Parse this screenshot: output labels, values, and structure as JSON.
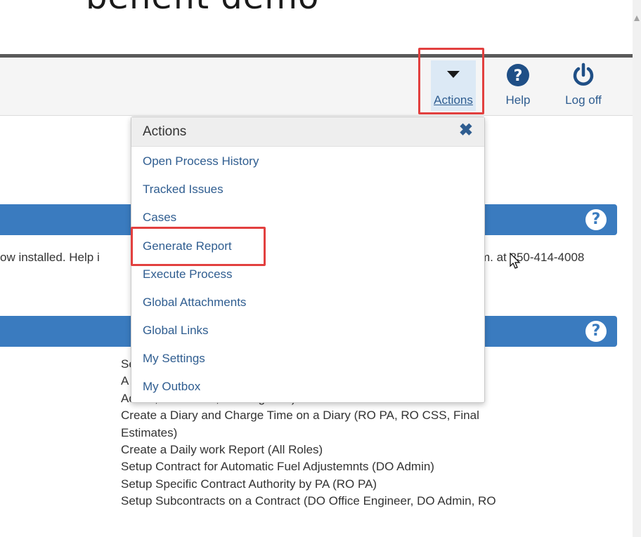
{
  "page_heading": "benefit demo",
  "header": {
    "actions_label": "Actions",
    "help_label": "Help",
    "logoff_label": "Log off"
  },
  "icons": {
    "actions": "caret-down-icon",
    "help": "question-circle-icon",
    "logoff": "power-icon",
    "close": "close-x-icon",
    "panel_help": "question-circle-icon"
  },
  "colors": {
    "accent": "#3a7bbf",
    "link": "#2f5d90",
    "highlight": "#e2403f"
  },
  "notice": {
    "left_text": "ow installed.  Help i",
    "right_text": "m. at 850-414-4008"
  },
  "actions_menu": {
    "title": "Actions",
    "items": [
      "Open Process History",
      "Tracked Issues",
      "Cases",
      "Generate Report",
      "Execute Process",
      "Global Attachments",
      "Global Links",
      "My Settings",
      "My Outbox"
    ]
  },
  "content_links": [
    "Se                                                          GR)",
    "A                                                            List (CO",
    "Admin, DO Admin, DO Engineer)",
    "Create a Diary and Charge Time on a Diary (RO PA, RO CSS, Final",
    "Estimates)",
    "Create a Daily work Report (All Roles)",
    "Setup Contract for Automatic Fuel Adjustemnts (DO Admin)",
    "Setup Specific Contract Authority by PA (RO PA)",
    "Setup Subcontracts on a Contract (DO Office Engineer, DO Admin, RO"
  ]
}
